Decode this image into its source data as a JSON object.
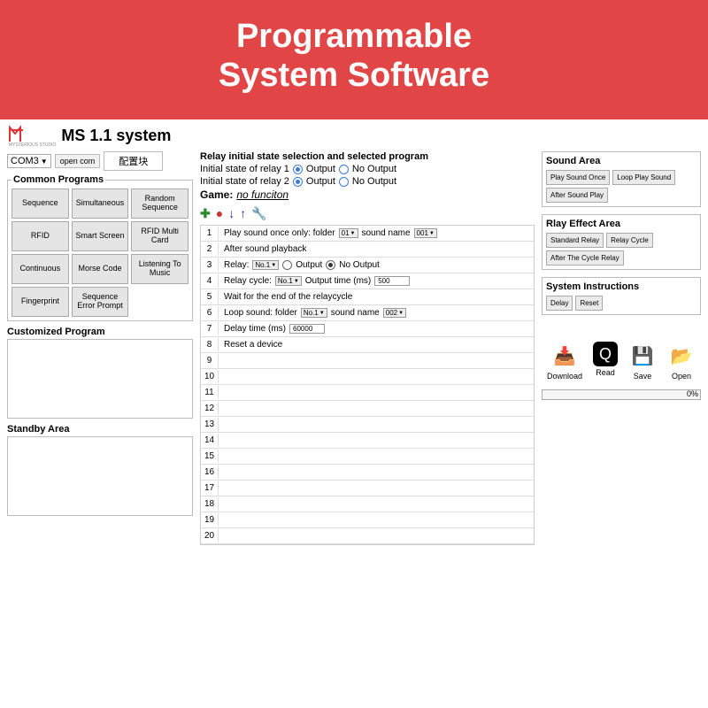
{
  "banner": {
    "line1": "Programmable",
    "line2": "System Software"
  },
  "app_title": "MS 1.1 system",
  "logo_sub": "MYSTERIOUS STUDIO",
  "com": {
    "port": "COM3",
    "open_btn": "open com",
    "config_btn": "配置块"
  },
  "common_programs": {
    "legend": "Common Programs",
    "items": [
      "Sequence",
      "Simultaneous",
      "Random Sequence",
      "RFID",
      "Smart Screen",
      "RFID Multi Card",
      "Continuous",
      "Morse Code",
      "Listening To Music",
      "Fingerprint",
      "Sequence Error Prompt",
      ""
    ]
  },
  "customized_program": {
    "legend": "Customized Program"
  },
  "standby_area": {
    "legend": "Standby Area"
  },
  "relay": {
    "title": "Relay initial state selection and selected program",
    "row1_label": "Initial state of relay 1",
    "row2_label": "Initial state of relay 2",
    "opt_output": "Output",
    "opt_nooutput": "No Output",
    "game_label": "Game:",
    "game_value": "no funciton"
  },
  "steps": [
    {
      "n": "1",
      "parts": [
        "Play sound once only: folder",
        {
          "combo": "01"
        },
        "sound name",
        {
          "combo": "001"
        }
      ]
    },
    {
      "n": "2",
      "parts": [
        "After sound playback"
      ]
    },
    {
      "n": "3",
      "parts": [
        "Relay:",
        {
          "combo": "No.1"
        },
        {
          "radio": false
        },
        "Output",
        {
          "radio": true
        },
        "No Output"
      ]
    },
    {
      "n": "4",
      "parts": [
        "Relay cycle:",
        {
          "combo": "No.1"
        },
        "Output time (ms)",
        {
          "input": "500"
        }
      ]
    },
    {
      "n": "5",
      "parts": [
        "Wait for the end of the relaycycle"
      ]
    },
    {
      "n": "6",
      "parts": [
        "Loop sound: folder",
        {
          "combo": "No.1"
        },
        "sound name",
        {
          "combo": "002"
        }
      ]
    },
    {
      "n": "7",
      "parts": [
        "Delay time (ms)",
        {
          "input": "60000"
        }
      ]
    },
    {
      "n": "8",
      "parts": [
        "Reset a device"
      ]
    },
    {
      "n": "9",
      "parts": []
    },
    {
      "n": "10",
      "parts": []
    },
    {
      "n": "11",
      "parts": []
    },
    {
      "n": "12",
      "parts": []
    },
    {
      "n": "13",
      "parts": []
    },
    {
      "n": "14",
      "parts": []
    },
    {
      "n": "15",
      "parts": []
    },
    {
      "n": "16",
      "parts": []
    },
    {
      "n": "17",
      "parts": []
    },
    {
      "n": "18",
      "parts": []
    },
    {
      "n": "19",
      "parts": []
    },
    {
      "n": "20",
      "parts": []
    }
  ],
  "sound_area": {
    "title": "Sound Area",
    "items": [
      "Play Sound Once",
      "Loop Play Sound",
      "After Sound Play"
    ]
  },
  "relay_effect": {
    "title": "Rlay Effect Area",
    "items": [
      "Standard Relay",
      "Relay Cycle",
      "After The Cycle Relay"
    ]
  },
  "sys_instr": {
    "title": "System Instructions",
    "items": [
      "Delay",
      "Reset"
    ]
  },
  "actions": {
    "download": "Download",
    "read": "Read",
    "save": "Save",
    "open": "Open"
  },
  "progress": "0%"
}
